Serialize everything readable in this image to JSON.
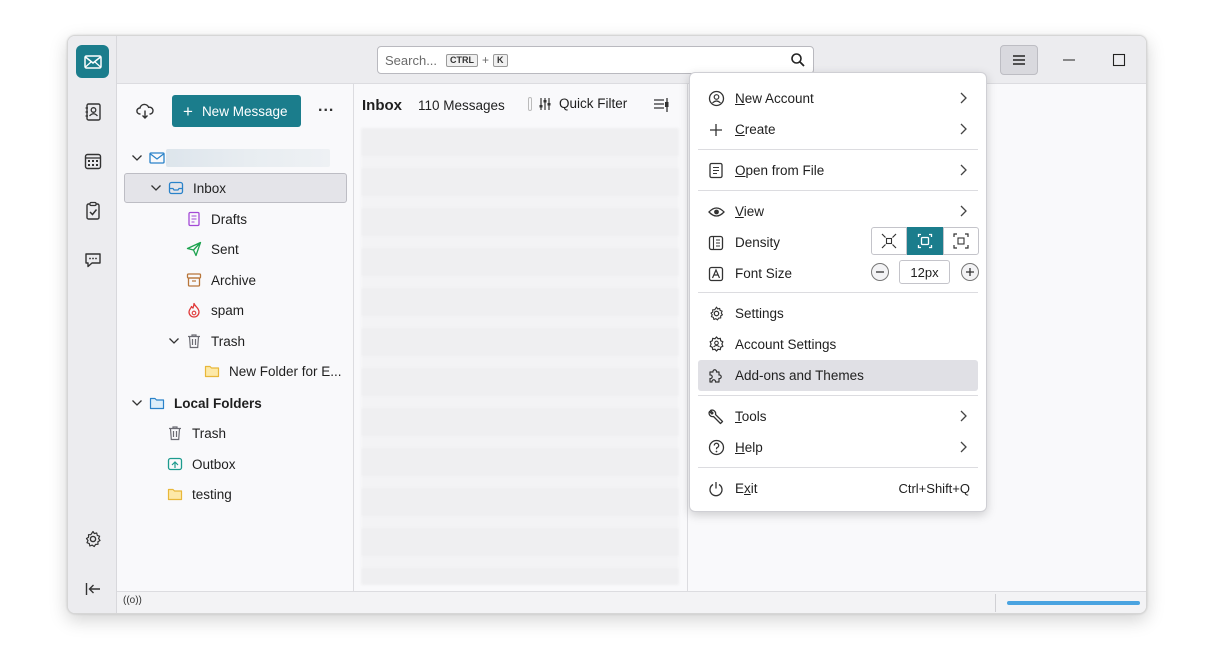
{
  "search": {
    "placeholder": "Search...",
    "kbd1": "CTRL",
    "plus": "+",
    "kbd2": "K"
  },
  "folder_pane": {
    "new_message_label": "New Message",
    "more_label": "...",
    "account_name": "",
    "folders": [
      {
        "label": "Inbox",
        "icon": "inbox-icon"
      },
      {
        "label": "Drafts",
        "icon": "drafts-icon"
      },
      {
        "label": "Sent",
        "icon": "sent-icon"
      },
      {
        "label": "Archive",
        "icon": "archive-icon"
      },
      {
        "label": "spam",
        "icon": "spam-icon"
      },
      {
        "label": "Trash",
        "icon": "trash-icon"
      },
      {
        "label": "New Folder for E...",
        "icon": "folder-icon"
      }
    ],
    "local_folders": {
      "label": "Local Folders",
      "items": [
        {
          "label": "Trash",
          "icon": "trash-icon"
        },
        {
          "label": "Outbox",
          "icon": "outbox-icon"
        },
        {
          "label": "testing",
          "icon": "folder-icon"
        }
      ]
    }
  },
  "thread_pane": {
    "title": "Inbox",
    "count": "110 Messages",
    "quick_filter": "Quick Filter"
  },
  "app_menu": {
    "new_account": {
      "prefix": "",
      "accel": "N",
      "rest": "ew Account"
    },
    "create": {
      "accel": "C",
      "rest": "reate"
    },
    "open_from_file": {
      "accel": "O",
      "rest": "pen from File"
    },
    "view": {
      "accel": "V",
      "rest": "iew"
    },
    "density": "Density",
    "font_size": "Font Size",
    "font_size_value": "12px",
    "settings": "Settings",
    "account_settings": "Account Settings",
    "addons": "Add-ons and Themes",
    "tools": {
      "accel": "T",
      "rest": "ools"
    },
    "help": {
      "accel": "H",
      "rest": "elp"
    },
    "exit": {
      "first": "E",
      "accel": "x",
      "rest": "it"
    },
    "exit_shortcut": "Ctrl+Shift+Q"
  },
  "status_bar": {
    "online_indicator": "((o))"
  },
  "colors": {
    "accent": "#1b7d8c",
    "progress": "#4aa3e0"
  }
}
